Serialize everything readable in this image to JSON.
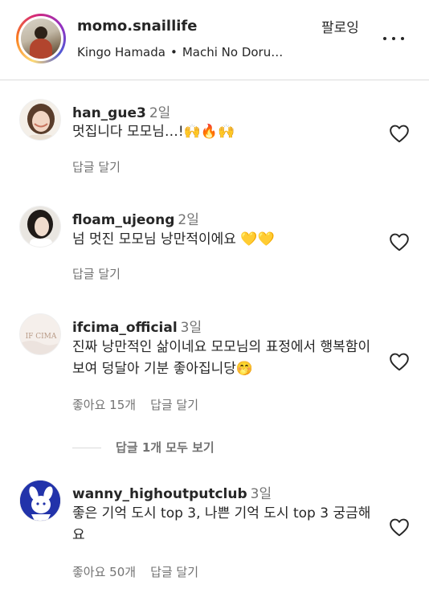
{
  "post_header": {
    "username": "momo.snaillife",
    "follow_label": "팔로잉",
    "audio_artist": "Kingo Hamada",
    "audio_separator": "•",
    "audio_track": "Machi No Doru…"
  },
  "comments": [
    {
      "username": "han_gue3",
      "time": "2일",
      "text": "멋집니다 모모님…!🙌🔥🙌",
      "reply_label": "답글 달기"
    },
    {
      "username": "floam_ujeong",
      "time": "2일",
      "text": "넘 멋진 모모님 낭만적이에요 💛💛",
      "reply_label": "답글 달기"
    },
    {
      "username": "ifcima_official",
      "time": "3일",
      "text": "진짜 낭만적인 삶이네요 모모님의 표정에서 행복함이 보여 덩달아 기분 좋아집니당🤭",
      "likes_label": "좋아요 15개",
      "reply_label": "답글 달기",
      "avatar_text": "IF CIMA"
    },
    {
      "username": "wanny_highoutputclub",
      "time": "3일",
      "text": "좋은 기억 도시 top 3, 나쁜 기억 도시 top 3 궁금해요",
      "likes_label": "좋아요 50개",
      "reply_label": "답글 달기"
    }
  ],
  "view_replies_label": "답글 1개 모두 보기",
  "colors": {
    "text_primary": "#262626",
    "text_secondary": "#737373",
    "divider": "#dbdbdb",
    "avatar_blue": "#2233aa"
  }
}
